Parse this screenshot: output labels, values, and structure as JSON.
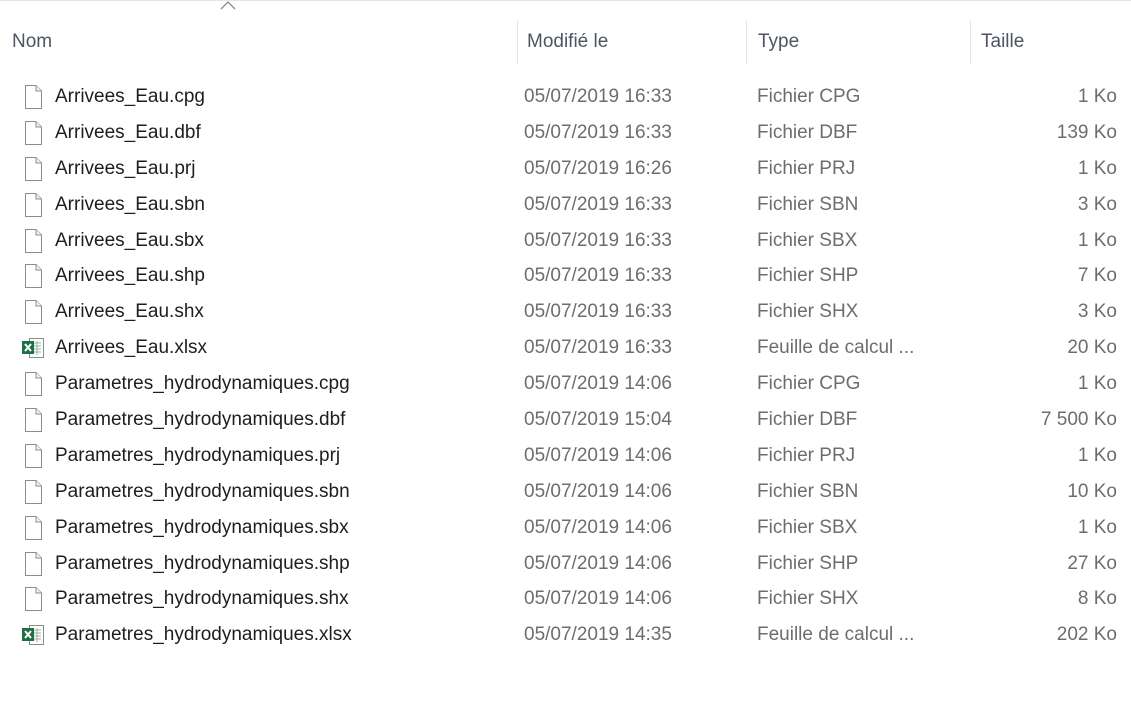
{
  "columns": {
    "name": "Nom",
    "modified": "Modifié le",
    "type": "Type",
    "size": "Taille"
  },
  "files": [
    {
      "name": "Arrivees_Eau.cpg",
      "modified": "05/07/2019 16:33",
      "type": "Fichier CPG",
      "size": "1 Ko",
      "icon": "file-icon"
    },
    {
      "name": "Arrivees_Eau.dbf",
      "modified": "05/07/2019 16:33",
      "type": "Fichier DBF",
      "size": "139 Ko",
      "icon": "file-icon"
    },
    {
      "name": "Arrivees_Eau.prj",
      "modified": "05/07/2019 16:26",
      "type": "Fichier PRJ",
      "size": "1 Ko",
      "icon": "file-icon"
    },
    {
      "name": "Arrivees_Eau.sbn",
      "modified": "05/07/2019 16:33",
      "type": "Fichier SBN",
      "size": "3 Ko",
      "icon": "file-icon"
    },
    {
      "name": "Arrivees_Eau.sbx",
      "modified": "05/07/2019 16:33",
      "type": "Fichier SBX",
      "size": "1 Ko",
      "icon": "file-icon"
    },
    {
      "name": "Arrivees_Eau.shp",
      "modified": "05/07/2019 16:33",
      "type": "Fichier SHP",
      "size": "7 Ko",
      "icon": "file-icon"
    },
    {
      "name": "Arrivees_Eau.shx",
      "modified": "05/07/2019 16:33",
      "type": "Fichier SHX",
      "size": "3 Ko",
      "icon": "file-icon"
    },
    {
      "name": "Arrivees_Eau.xlsx",
      "modified": "05/07/2019 16:33",
      "type": "Feuille de calcul ...",
      "size": "20 Ko",
      "icon": "excel-icon"
    },
    {
      "name": "Parametres_hydrodynamiques.cpg",
      "modified": "05/07/2019 14:06",
      "type": "Fichier CPG",
      "size": "1 Ko",
      "icon": "file-icon"
    },
    {
      "name": "Parametres_hydrodynamiques.dbf",
      "modified": "05/07/2019 15:04",
      "type": "Fichier DBF",
      "size": "7 500 Ko",
      "icon": "file-icon"
    },
    {
      "name": "Parametres_hydrodynamiques.prj",
      "modified": "05/07/2019 14:06",
      "type": "Fichier PRJ",
      "size": "1 Ko",
      "icon": "file-icon"
    },
    {
      "name": "Parametres_hydrodynamiques.sbn",
      "modified": "05/07/2019 14:06",
      "type": "Fichier SBN",
      "size": "10 Ko",
      "icon": "file-icon"
    },
    {
      "name": "Parametres_hydrodynamiques.sbx",
      "modified": "05/07/2019 14:06",
      "type": "Fichier SBX",
      "size": "1 Ko",
      "icon": "file-icon"
    },
    {
      "name": "Parametres_hydrodynamiques.shp",
      "modified": "05/07/2019 14:06",
      "type": "Fichier SHP",
      "size": "27 Ko",
      "icon": "file-icon"
    },
    {
      "name": "Parametres_hydrodynamiques.shx",
      "modified": "05/07/2019 14:06",
      "type": "Fichier SHX",
      "size": "8 Ko",
      "icon": "file-icon"
    },
    {
      "name": "Parametres_hydrodynamiques.xlsx",
      "modified": "05/07/2019 14:35",
      "type": "Feuille de calcul ...",
      "size": "202 Ko",
      "icon": "excel-icon"
    }
  ],
  "colors": {
    "header_text": "#4d5562",
    "secondary_text": "#6d6d6d",
    "excel_green": "#1d7044"
  }
}
